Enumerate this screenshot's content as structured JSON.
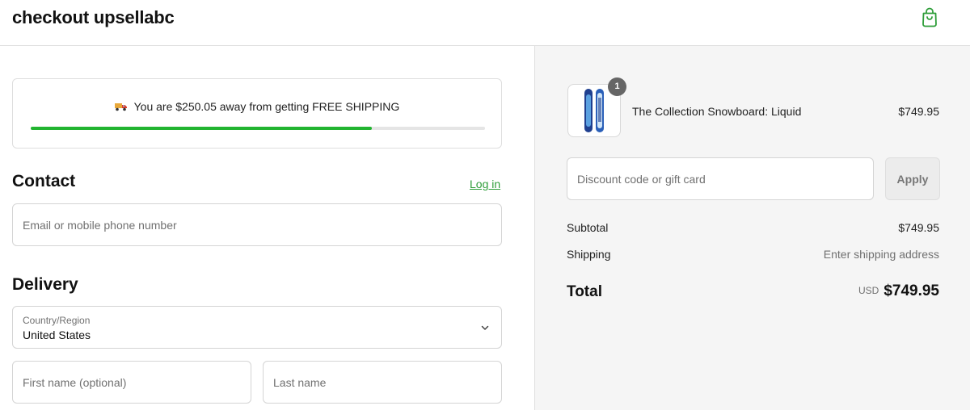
{
  "header": {
    "brand": "checkout upsellabc",
    "cart_icon": "shopping-bag-icon",
    "accent_color": "#2f9e3a"
  },
  "shipping_banner": {
    "icon": "truck-icon",
    "text": "You are $250.05 away from getting FREE SHIPPING",
    "progress_fraction": 0.75,
    "progress_color": "#22b430"
  },
  "contact": {
    "title": "Contact",
    "login_link": "Log in",
    "email_placeholder": "Email or mobile phone number"
  },
  "delivery": {
    "title": "Delivery",
    "country_label": "Country/Region",
    "country_value": "United States",
    "first_name_placeholder": "First name (optional)",
    "last_name_placeholder": "Last name"
  },
  "summary": {
    "product": {
      "name": "The Collection Snowboard: Liquid",
      "price": "$749.95",
      "quantity": "1"
    },
    "discount_placeholder": "Discount code or gift card",
    "apply_label": "Apply",
    "subtotal_label": "Subtotal",
    "subtotal_value": "$749.95",
    "shipping_label": "Shipping",
    "shipping_value": "Enter shipping address",
    "total_label": "Total",
    "currency": "USD",
    "total_value": "$749.95"
  }
}
